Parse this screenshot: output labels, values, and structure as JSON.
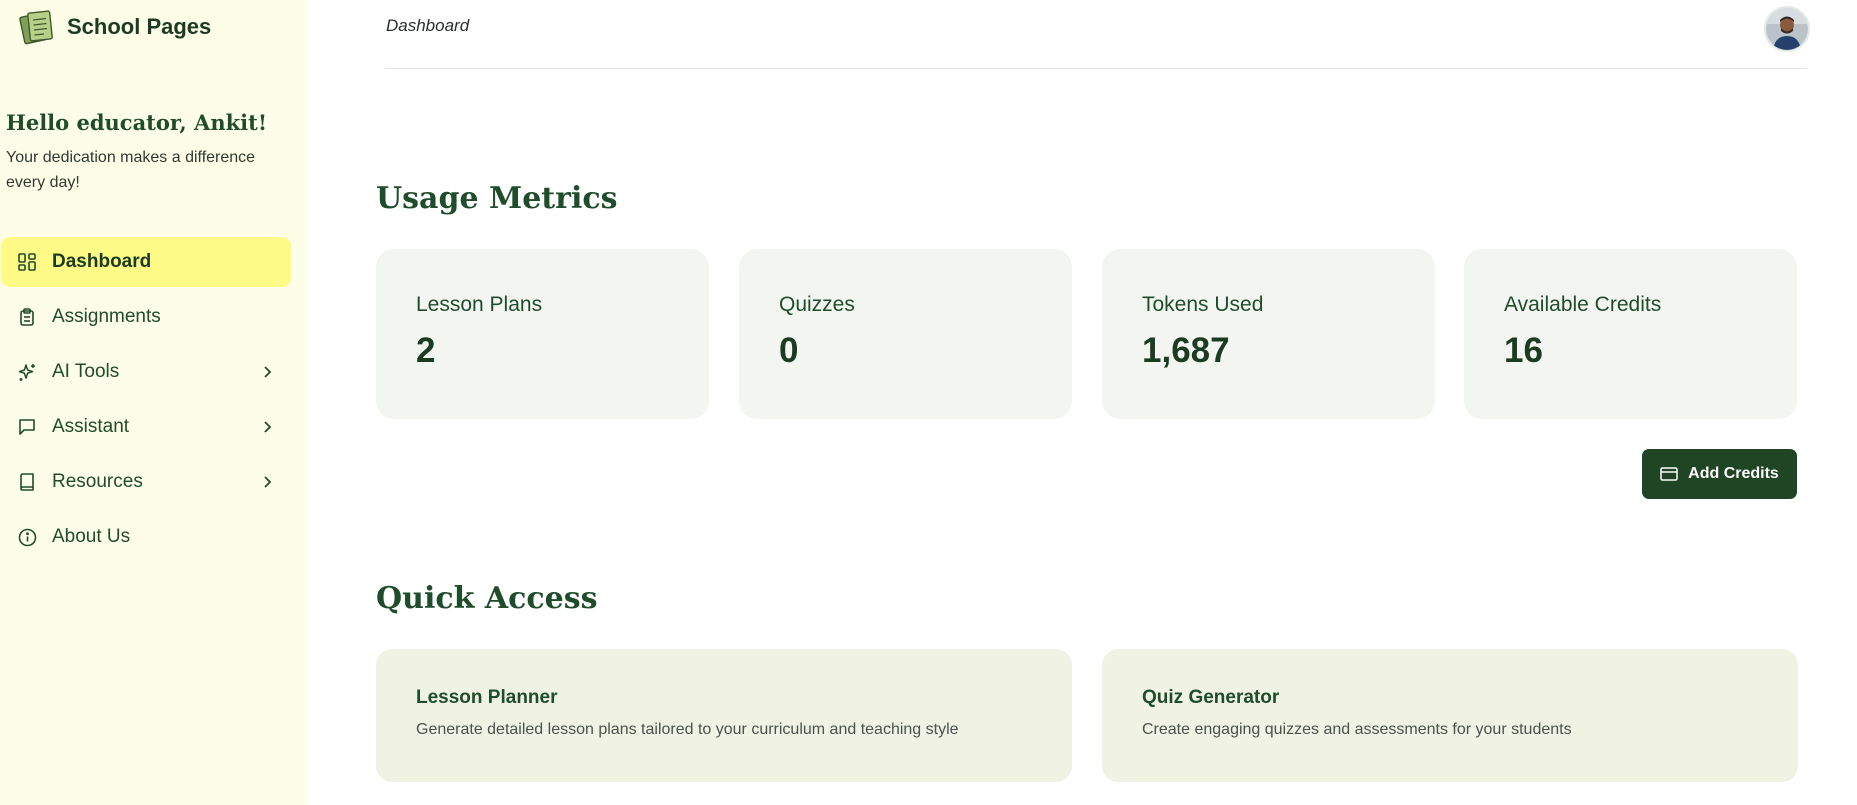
{
  "brand": {
    "name": "School Pages",
    "logo_icon": "notebook-icon"
  },
  "greeting": {
    "title": "Hello educator, Ankit!",
    "subtitle": "Your dedication makes a difference every day!"
  },
  "sidebar": {
    "items": [
      {
        "label": "Dashboard",
        "icon": "dashboard-icon",
        "active": true
      },
      {
        "label": "Assignments",
        "icon": "clipboard-icon"
      },
      {
        "label": "AI Tools",
        "icon": "sparkle-icon",
        "has_submenu": true
      },
      {
        "label": "Assistant",
        "icon": "chat-icon",
        "has_submenu": true
      },
      {
        "label": "Resources",
        "icon": "book-icon",
        "has_submenu": true
      },
      {
        "label": "About Us",
        "icon": "info-icon"
      }
    ]
  },
  "header": {
    "breadcrumb": "Dashboard",
    "avatar_icon": "user-avatar"
  },
  "usage": {
    "title": "Usage Metrics",
    "metrics": [
      {
        "label": "Lesson Plans",
        "value": "2"
      },
      {
        "label": "Quizzes",
        "value": "0"
      },
      {
        "label": "Tokens Used",
        "value": "1,687"
      },
      {
        "label": "Available Credits",
        "value": "16"
      }
    ],
    "add_credits_label": "Add Credits",
    "add_credits_icon": "credit-card-icon"
  },
  "quick_access": {
    "title": "Quick Access",
    "cards": [
      {
        "title": "Lesson Planner",
        "description": "Generate detailed lesson plans tailored to your curriculum and teaching style"
      },
      {
        "title": "Quiz Generator",
        "description": "Create engaging quizzes and assessments for your students"
      }
    ]
  },
  "colors": {
    "sidebar_bg": "#fefee8",
    "active_item": "#fdfb86",
    "primary_green": "#1f4524",
    "card_bg": "#f3f5f1",
    "quick_card_bg": "#f0f3e4"
  }
}
